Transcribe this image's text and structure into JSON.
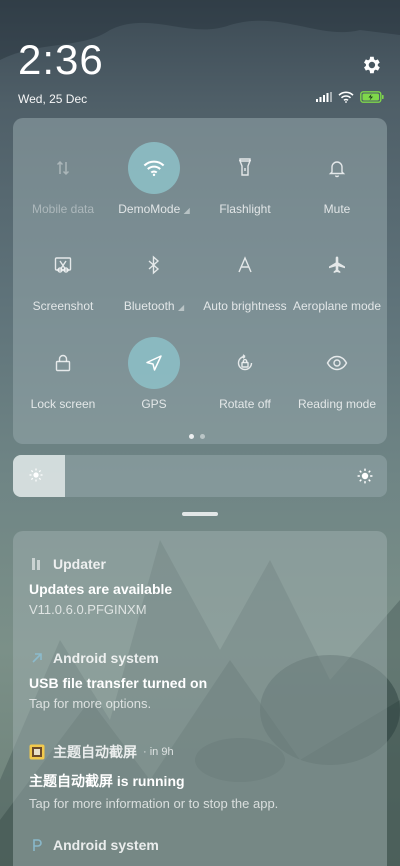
{
  "status": {
    "time": "2:36",
    "date": "Wed, 25 Dec",
    "icons": [
      "signal-icon",
      "wifi-icon",
      "battery-charging-icon"
    ],
    "settings_icon": "gear-icon"
  },
  "quick_settings": {
    "tiles": [
      {
        "label": "Mobile data",
        "icon": "mobile-data-icon",
        "active": false,
        "dimmed": true
      },
      {
        "label": "DemoMode",
        "icon": "wifi-icon",
        "active": true,
        "dimmed": false
      },
      {
        "label": "Flashlight",
        "icon": "flashlight-icon",
        "active": false,
        "dimmed": false
      },
      {
        "label": "Mute",
        "icon": "bell-icon",
        "active": false,
        "dimmed": false
      },
      {
        "label": "Screenshot",
        "icon": "screenshot-icon",
        "active": false,
        "dimmed": false
      },
      {
        "label": "Bluetooth",
        "icon": "bluetooth-icon",
        "active": false,
        "dimmed": false
      },
      {
        "label": "Auto brightness",
        "icon": "auto-brightness-icon",
        "active": false,
        "dimmed": false
      },
      {
        "label": "Aeroplane mode",
        "icon": "airplane-icon",
        "active": false,
        "dimmed": false
      },
      {
        "label": "Lock screen",
        "icon": "lock-icon",
        "active": false,
        "dimmed": false
      },
      {
        "label": "GPS",
        "icon": "location-arrow-icon",
        "active": true,
        "dimmed": false
      },
      {
        "label": "Rotate off",
        "icon": "rotate-lock-icon",
        "active": false,
        "dimmed": false
      },
      {
        "label": "Reading mode",
        "icon": "eye-icon",
        "active": false,
        "dimmed": false
      }
    ],
    "page_count": 2,
    "current_page": 1
  },
  "brightness": {
    "level": 0.14
  },
  "notifications": [
    {
      "app": "Updater",
      "meta": "",
      "icon": "updater-icon",
      "title": "Updates are available",
      "body": "V11.0.6.0.PFGINXM"
    },
    {
      "app": "Android system",
      "meta": "",
      "icon": "android-icon",
      "title": "USB file transfer turned on",
      "body": "Tap for more options."
    },
    {
      "app": "主题自动截屏",
      "meta": "· in 9h",
      "icon": "theme-screenshot-app-icon",
      "title": "主题自动截屏 is running",
      "body": "Tap for more information or to stop the app."
    },
    {
      "app": "Android system",
      "meta": "",
      "icon": "android-icon",
      "title": "",
      "body": ""
    }
  ],
  "colors": {
    "active_tile": "#8cbec4",
    "panel": "#96a8ac"
  }
}
